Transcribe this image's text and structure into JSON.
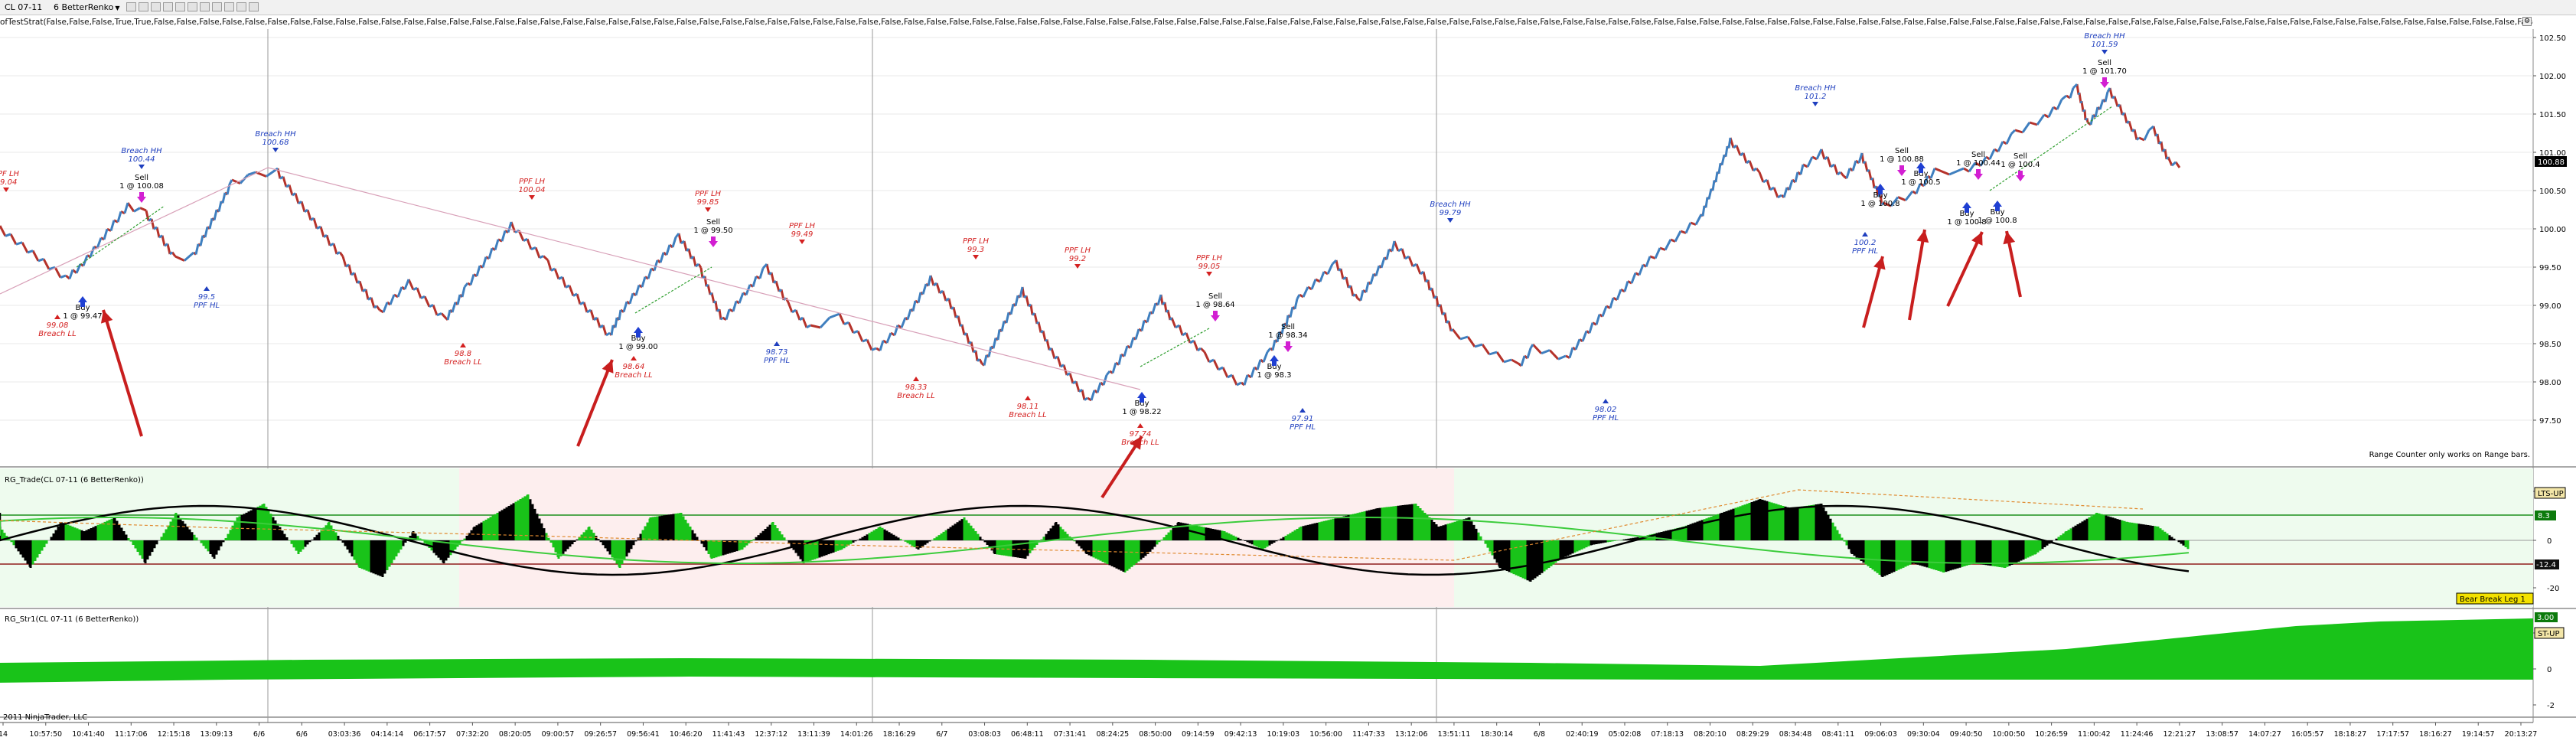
{
  "toolbar": {
    "instrument": "CL 07-11",
    "period": "6 BetterRenko",
    "params": "ofTestStrat(False,False,False,True,True,False,False,False,False,False,False,False,False,False,False,False,False,False,False,False,False,False,False,False,False,False,False,False,False,False,False,False,False,False,False,False,False,False,False,False,False,False,False,False,False,False,False,False,False,False,False,False,False,False,False,False,False,False,False,False,False,False,False,False,False,False,False,False,False,False,False,False,False,False,False,False,False,False,False,False,False,False,False,False,False,False,False,False,False,False,False,False,False,False,False,False,False,False,False,False,False,False,False,False,False,False,False,False,False,False,False,False,False,False,False,False,False,False,False,False,False,False,False,False,False,False,False,False,False,True,True,False,True,True,True,False,True"
  },
  "colors": {
    "bull": "#3f7fbf",
    "bear": "#b5322a",
    "histogram_green": "#19c319",
    "histogram_black": "#000000",
    "signal_blue": "#1f3fbf",
    "signal_red": "#d42020",
    "trend_line": "#d8a0b8",
    "annotation_arrow": "#c81e1e"
  },
  "price_axis": {
    "ticks": [
      "102.50",
      "102.00",
      "101.50",
      "101.00",
      "100.50",
      "100.00",
      "99.50",
      "99.00",
      "98.50",
      "98.00",
      "97.50"
    ],
    "current": "100.88",
    "footer_note": "Range Counter only works on Range bars."
  },
  "annotations": [
    {
      "kind": "red",
      "lines": [
        "PPF LH",
        "99.04"
      ]
    },
    {
      "kind": "blue",
      "lines": [
        "Breach HH",
        "100.44"
      ]
    },
    {
      "kind": "blue",
      "lines": [
        "Breach HH",
        "100.68"
      ]
    },
    {
      "kind": "red",
      "lines": [
        "PPF LH",
        "100.04"
      ]
    },
    {
      "kind": "red",
      "lines": [
        "PPF LH",
        "99.85"
      ]
    },
    {
      "kind": "red",
      "lines": [
        "PPF LH",
        "99.49"
      ]
    },
    {
      "kind": "red",
      "lines": [
        "PPF LH",
        "99.3"
      ]
    },
    {
      "kind": "red",
      "lines": [
        "PPF LH",
        "99.2"
      ]
    },
    {
      "kind": "red",
      "lines": [
        "PPF LH",
        "99.05"
      ]
    },
    {
      "kind": "blue",
      "lines": [
        "Breach HH",
        "99.79"
      ]
    },
    {
      "kind": "blue",
      "lines": [
        "Breach HH",
        "101.2"
      ]
    },
    {
      "kind": "blue",
      "lines": [
        "Breach HH",
        "101.59"
      ]
    },
    {
      "kind": "red",
      "lines": [
        "99.08",
        "Breach LL"
      ]
    },
    {
      "kind": "blue",
      "lines": [
        "99.5",
        "PPF HL"
      ]
    },
    {
      "kind": "red",
      "lines": [
        "98.8",
        "Breach LL"
      ]
    },
    {
      "kind": "red",
      "lines": [
        "98.64",
        "Breach LL"
      ]
    },
    {
      "kind": "blue",
      "lines": [
        "98.73",
        "PPF HL"
      ]
    },
    {
      "kind": "red",
      "lines": [
        "98.33",
        "Breach LL"
      ]
    },
    {
      "kind": "red",
      "lines": [
        "98.11",
        "Breach LL"
      ]
    },
    {
      "kind": "red",
      "lines": [
        "97.74",
        "Breach LL"
      ]
    },
    {
      "kind": "blue",
      "lines": [
        "97.91",
        "PPF HL"
      ]
    },
    {
      "kind": "blue",
      "lines": [
        "98.02",
        "PPF HL"
      ]
    },
    {
      "kind": "blue",
      "lines": [
        "100.2",
        "PPF HL"
      ]
    }
  ],
  "trades": [
    {
      "action": "Sell",
      "fill": "1 @ 100.08"
    },
    {
      "action": "Buy",
      "fill": "1 @ 99.47"
    },
    {
      "action": "Sell",
      "fill": "1 @ 99.50"
    },
    {
      "action": "Buy",
      "fill": "1 @ 99.00"
    },
    {
      "action": "Buy",
      "fill": "1 @ 98.22"
    },
    {
      "action": "Sell",
      "fill": "1 @ 98.64"
    },
    {
      "action": "Sell",
      "fill": "1 @ 98.34"
    },
    {
      "action": "Buy",
      "fill": "1 @ 98.3"
    },
    {
      "action": "Sell",
      "fill": "1 @ 100.88"
    },
    {
      "action": "Buy",
      "fill": "1 @ 100.8"
    },
    {
      "action": "Sell",
      "fill": "1 @ 100.44"
    },
    {
      "action": "Buy",
      "fill": "1 @ 100.5"
    },
    {
      "action": "Buy",
      "fill": "1 @ 100.8"
    },
    {
      "action": "Sell",
      "fill": "1 @ 101.70"
    },
    {
      "action": "Buy",
      "fill": "1 @ 100.8"
    },
    {
      "action": "Sell",
      "fill": "1 @ 100.4"
    }
  ],
  "panel2": {
    "title": "RG_Trade(CL 07-11 (6 BetterRenko))",
    "axis": [
      "20",
      "0",
      "-20"
    ],
    "badge_top": "LTS-UP",
    "value_top": "8.3",
    "value_bottom": "-12.4",
    "badge_bottom": "Bear Break Leg 1"
  },
  "panel3": {
    "title": "RG_Str1(CL 07-11 (6 BetterRenko))",
    "axis": [
      "2",
      "0",
      "-2"
    ],
    "badge": "ST-UP",
    "value": "3.00"
  },
  "time_axis": {
    "ticks": [
      "14",
      "10:57:50",
      "10:41:40",
      "11:17:06",
      "12:15:18",
      "13:09:13",
      "6/6",
      "6/6",
      "03:03:36",
      "04:14:14",
      "06:17:57",
      "07:32:20",
      "08:20:05",
      "09:00:57",
      "09:26:57",
      "09:56:41",
      "10:46:20",
      "11:41:43",
      "12:37:12",
      "13:11:39",
      "14:01:26",
      "18:16:29",
      "6/7",
      "03:08:03",
      "06:48:11",
      "07:31:41",
      "08:24:25",
      "08:50:00",
      "09:14:59",
      "09:42:13",
      "10:19:03",
      "10:56:00",
      "11:47:33",
      "13:12:06",
      "13:51:11",
      "18:30:14",
      "6/8",
      "02:40:19",
      "05:02:08",
      "07:18:13",
      "08:20:10",
      "08:29:29",
      "08:34:48",
      "08:41:11",
      "09:06:03",
      "09:30:04",
      "09:40:50",
      "10:00:50",
      "10:26:59",
      "11:00:42",
      "11:24:46",
      "12:21:27",
      "13:08:57",
      "14:07:27",
      "16:05:57",
      "18:18:27",
      "17:17:57",
      "18:16:27",
      "19:14:57",
      "20:13:27"
    ],
    "copyright": "2011 NinjaTrader, LLC"
  }
}
